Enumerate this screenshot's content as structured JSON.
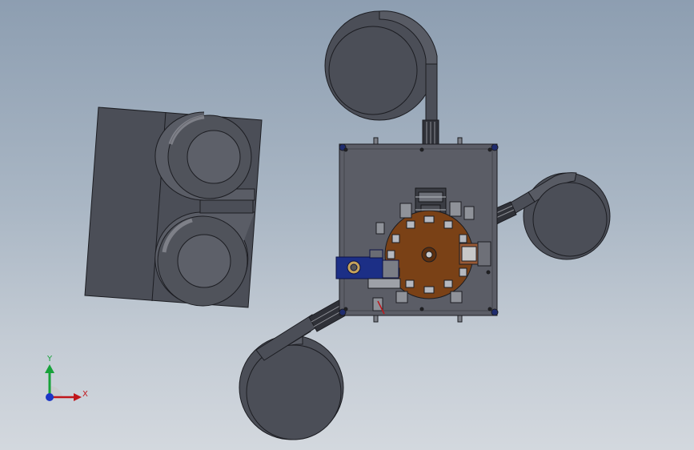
{
  "viewport": {
    "background_top": "#8d9eb1",
    "background_bottom": "#d3d8de"
  },
  "colors": {
    "part_dark": "#4b4e57",
    "part_edge": "#1c1d22",
    "bowl_inner": "#585b64",
    "table_top": "#5b5d66",
    "turntable": "#7a4116",
    "motor_blue": "#1c2f86",
    "axis_x": "#c0161b",
    "axis_y": "#17a23a",
    "axis_z": "#1b36c6"
  },
  "triad": {
    "x_label": "X",
    "y_label": "Y"
  },
  "icons": {
    "triad": "coordinate-triad-icon"
  }
}
